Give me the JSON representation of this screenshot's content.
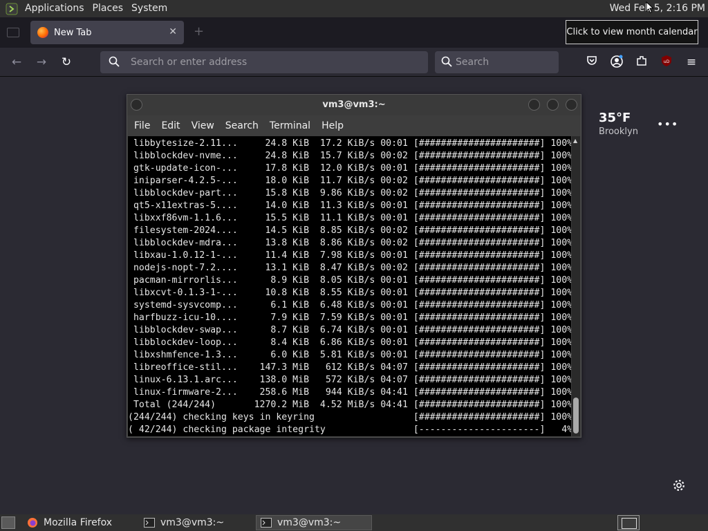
{
  "panel": {
    "menus": [
      "Applications",
      "Places",
      "System"
    ],
    "clock": "Wed Feb  5,  2:16 PM"
  },
  "tooltip": "Click to view month calendar",
  "firefox": {
    "tab_title": "New Tab",
    "address_placeholder": "Search or enter address",
    "search_placeholder": "Search",
    "weather": {
      "temperature": "35°F",
      "city": "Brooklyn"
    }
  },
  "terminal": {
    "title": "vm3@vm3:~",
    "menus": [
      "File",
      "Edit",
      "View",
      "Search",
      "Terminal",
      "Help"
    ],
    "lines": [
      " libbytesize-2.11...     24.8 KiB  17.2 KiB/s 00:01 [######################] 100%",
      " libblockdev-nvme...     24.8 KiB  15.7 KiB/s 00:02 [######################] 100%",
      " gtk-update-icon-...     17.8 KiB  12.0 KiB/s 00:01 [######################] 100%",
      " iniparser-4.2.5-...     18.0 KiB  11.7 KiB/s 00:02 [######################] 100%",
      " libblockdev-part...     15.8 KiB  9.86 KiB/s 00:02 [######################] 100%",
      " qt5-x11extras-5....     14.0 KiB  11.3 KiB/s 00:01 [######################] 100%",
      " libxxf86vm-1.1.6...     15.5 KiB  11.1 KiB/s 00:01 [######################] 100%",
      " filesystem-2024....     14.5 KiB  8.85 KiB/s 00:02 [######################] 100%",
      " libblockdev-mdra...     13.8 KiB  8.86 KiB/s 00:02 [######################] 100%",
      " libxau-1.0.12-1-...     11.4 KiB  7.98 KiB/s 00:01 [######################] 100%",
      " nodejs-nopt-7.2....     13.1 KiB  8.47 KiB/s 00:02 [######################] 100%",
      " pacman-mirrorlis...      8.9 KiB  8.05 KiB/s 00:01 [######################] 100%",
      " libxcvt-0.1.3-1-...     10.8 KiB  8.55 KiB/s 00:01 [######################] 100%",
      " systemd-sysvcomp...      6.1 KiB  6.48 KiB/s 00:01 [######################] 100%",
      " harfbuzz-icu-10....      7.9 KiB  7.59 KiB/s 00:01 [######################] 100%",
      " libblockdev-swap...      8.7 KiB  6.74 KiB/s 00:01 [######################] 100%",
      " libblockdev-loop...      8.4 KiB  6.86 KiB/s 00:01 [######################] 100%",
      " libxshmfence-1.3...      6.0 KiB  5.81 KiB/s 00:01 [######################] 100%",
      " libreoffice-stil...    147.3 MiB   612 KiB/s 04:07 [######################] 100%",
      " linux-6.13.1.arc...    138.0 MiB   572 KiB/s 04:07 [######################] 100%",
      " linux-firmware-2...    258.6 MiB   944 KiB/s 04:41 [######################] 100%",
      " Total (244/244)       1270.2 MiB  4.52 MiB/s 04:41 [######################] 100%",
      "(244/244) checking keys in keyring                  [######################] 100%",
      "( 42/244) checking package integrity                [----------------------]   4%"
    ]
  },
  "taskbar": {
    "items": [
      "Mozilla Firefox",
      "vm3@vm3:~",
      "vm3@vm3:~"
    ]
  },
  "colors": {
    "firefox_bg": "#2b2a33",
    "panel_bg": "#303030",
    "terminal_bg": "#000000"
  }
}
